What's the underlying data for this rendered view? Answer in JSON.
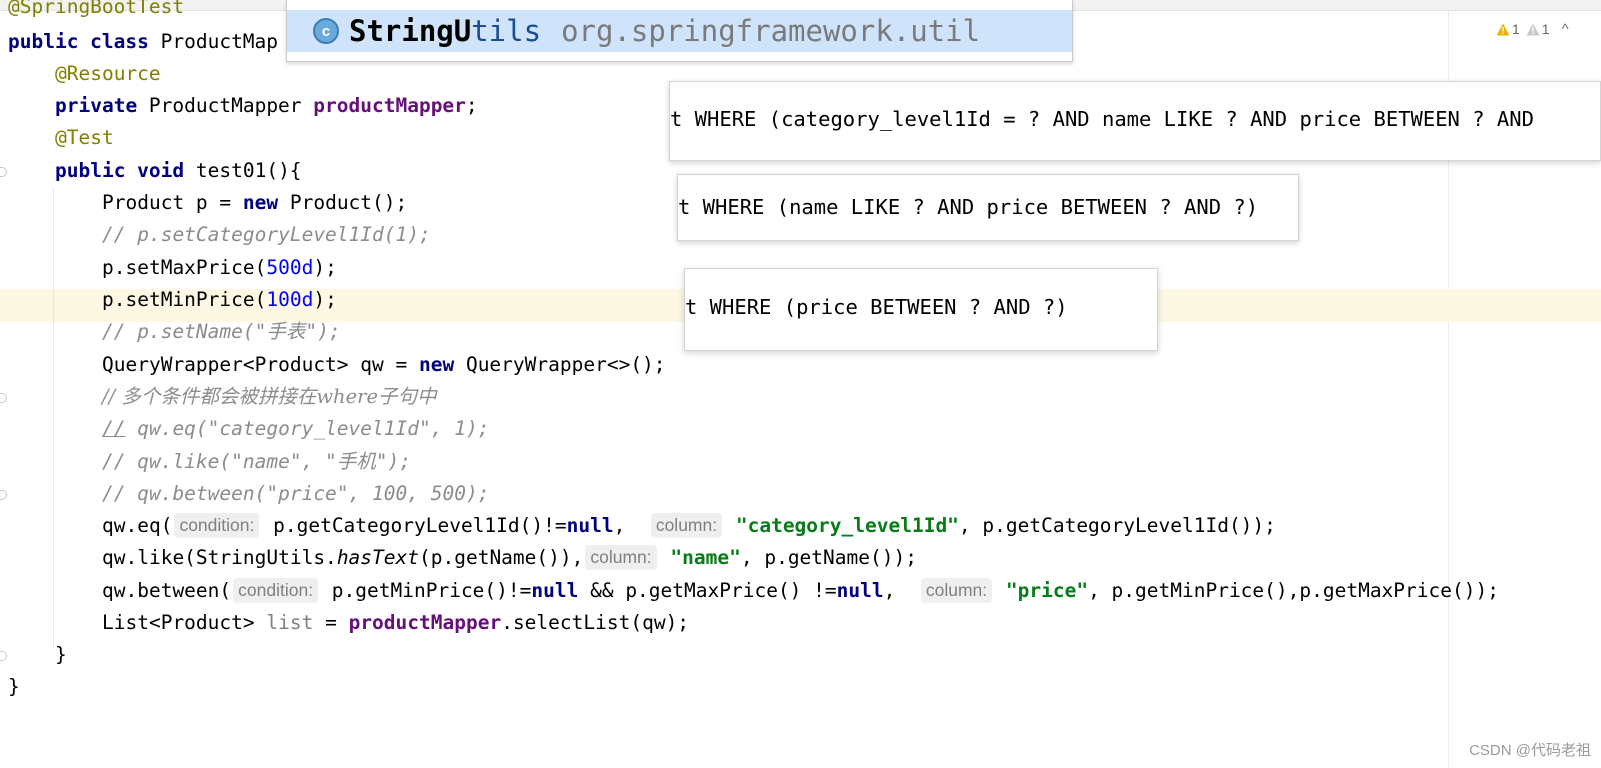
{
  "editor": {
    "top_partial_annotation": "@SpringBootTest",
    "lines": {
      "class_decl": [
        "public class ",
        "ProductMap"
      ],
      "resource": "@Resource",
      "field": [
        "private ",
        "ProductMapper ",
        "productMapper",
        ";"
      ],
      "test_ann": "@Test",
      "method": [
        "public void ",
        "test01(){"
      ],
      "new_product": [
        "Product p = ",
        "new ",
        "Product();"
      ],
      "c_setcat": "// p.setCategoryLevel1Id(1);",
      "set_max": [
        "p.setMaxPrice(",
        "500d",
        ");"
      ],
      "set_min": [
        "p.setMinPrice(",
        "100d",
        ");"
      ],
      "c_setname": "// p.setName(\"手表\");",
      "new_qw": [
        "QueryWrapper<Product> qw = ",
        "new ",
        "QueryWrapper<>();"
      ],
      "c_multi": "// 多个条件都会被拼接在where子句中",
      "c_eq": [
        "//",
        " qw.eq(\"category_level1Id\", 1);"
      ],
      "c_like": "// qw.like(\"name\", \"手机\");",
      "c_between": "// qw.between(\"price\", 100, 500);",
      "eq": [
        "qw.eq(",
        "condition:",
        " p.getCategoryLevel1Id()!=",
        "null",
        ",  ",
        "column:",
        " ",
        "\"category_level1Id\"",
        ", p.getCategoryLevel1Id());"
      ],
      "like": [
        "qw.like(StringUtils.",
        "hasText",
        "(p.getName()),",
        "column:",
        " ",
        "\"name\"",
        ", p.getName());"
      ],
      "between": [
        "qw.between(",
        "condition:",
        " p.getMinPrice()!=",
        "null",
        " && p.getMaxPrice() !=",
        "null",
        ",  ",
        "column:",
        " ",
        "\"price\"",
        ", p.getMinPrice(),p.getMaxPrice());"
      ],
      "select": [
        "List<Product> ",
        "list",
        " = ",
        "productMapper",
        ".selectList(qw);"
      ],
      "close_method": "}",
      "close_class": "}"
    }
  },
  "inspections": {
    "warning_count_1": "1",
    "warning_count_2": "1",
    "chevron": "^"
  },
  "autocomplete": {
    "class_icon_letter": "c",
    "class_name_match": "StringU",
    "class_name_rest": "tils",
    "package": "org.springframework.util"
  },
  "sql_overlays": {
    "sql1": "t WHERE (category_level1Id = ? AND name LIKE ? AND price BETWEEN ? AND",
    "sql2": "t WHERE (name LIKE ? AND price BETWEEN ? AND ?)",
    "sql3": "t WHERE (price BETWEEN ? AND ?)"
  },
  "watermark": "CSDN @代码老祖",
  "colors": {
    "keyword": "#000080",
    "annotation": "#808000",
    "field": "#660e7a",
    "number": "#0000ff",
    "string": "#067d17",
    "comment": "#8c8c8c",
    "current_line": "#fcf8e3",
    "selection": "#cfe3fb",
    "warning": "#e8b400"
  }
}
